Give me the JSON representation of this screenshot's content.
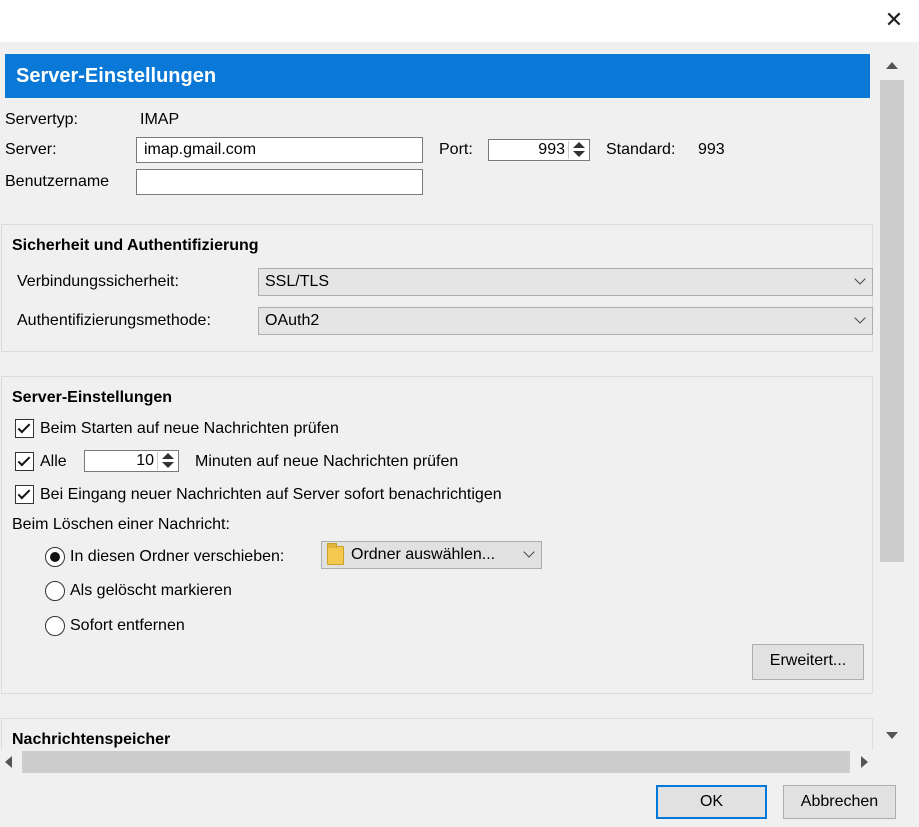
{
  "window": {
    "close_glyph": "✕"
  },
  "header": {
    "title": "Server-Einstellungen"
  },
  "server": {
    "type_label": "Servertyp:",
    "type_value": "IMAP",
    "server_label": "Server:",
    "server_value": "imap.gmail.com",
    "port_label": "Port:",
    "port_value": "993",
    "standard_label": "Standard:",
    "standard_value": "993",
    "username_label": "Benutzername",
    "username_value": ""
  },
  "security": {
    "title": "Sicherheit und Authentifizierung",
    "connection_label": "Verbindungssicherheit:",
    "connection_value": "SSL/TLS",
    "auth_label": "Authentifizierungsmethode:",
    "auth_value": "OAuth2"
  },
  "settings": {
    "title": "Server-Einstellungen",
    "check_on_start": {
      "label": "Beim Starten auf neue Nachrichten prüfen",
      "checked": true
    },
    "check_every": {
      "label": "Alle",
      "checked": true,
      "minutes": "10",
      "suffix": "Minuten auf neue Nachrichten prüfen"
    },
    "notify_new": {
      "label": "Bei Eingang neuer Nachrichten auf Server sofort benachrichtigen",
      "checked": true
    },
    "delete_label": "Beim Löschen einer Nachricht:",
    "delete_options": [
      {
        "label": "In diesen Ordner verschieben:",
        "selected": true
      },
      {
        "label": "Als gelöscht markieren",
        "selected": false
      },
      {
        "label": "Sofort entfernen",
        "selected": false
      }
    ],
    "folder_button": "Ordner auswählen...",
    "advanced_button": "Erweitert..."
  },
  "storage": {
    "title": "Nachrichtenspeicher"
  },
  "footer": {
    "ok": "OK",
    "cancel": "Abbrechen"
  },
  "colors": {
    "header_bg": "#0a78d7",
    "ok_border": "#0078d7"
  },
  "icons": [
    "close-icon",
    "spin-up-icon",
    "spin-down-icon",
    "chevron-down-icon",
    "folder-icon",
    "scroll-up-icon",
    "scroll-down-icon",
    "scroll-left-icon",
    "scroll-right-icon",
    "checkmark-icon"
  ]
}
